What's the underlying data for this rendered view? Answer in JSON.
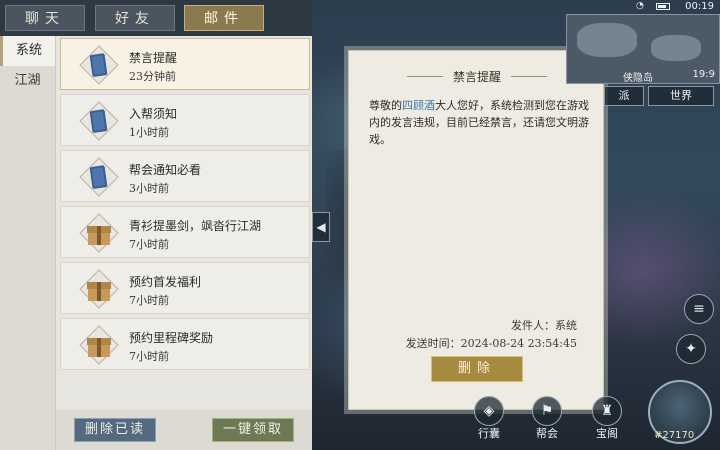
{
  "tabs": [
    {
      "label": "聊天"
    },
    {
      "label": "好友"
    },
    {
      "label": "邮件"
    }
  ],
  "side": [
    {
      "label": "系统"
    },
    {
      "label": "江湖"
    }
  ],
  "mails": [
    {
      "subject": "禁言提醒",
      "time": "23分钟前",
      "icon": "letter-icon"
    },
    {
      "subject": "入帮须知",
      "time": "1小时前",
      "icon": "letter-icon"
    },
    {
      "subject": "帮会通知必看",
      "time": "3小时前",
      "icon": "letter-icon"
    },
    {
      "subject": "青衫提墨剑，飒沓行江湖",
      "time": "7小时前",
      "icon": "gift-box-icon"
    },
    {
      "subject": "预约首发福利",
      "time": "7小时前",
      "icon": "gift-box-icon"
    },
    {
      "subject": "预约里程碑奖励",
      "time": "7小时前",
      "icon": "gift-box-icon"
    }
  ],
  "buttons": {
    "delete_read": "删除已读",
    "claim_all": "一键领取",
    "delete": "删除"
  },
  "letter": {
    "title": "禁言提醒",
    "body_pre": "尊敬的",
    "body_name": "四顾酒",
    "body_post": "大人您好，系统检测到您在游戏内的发言违规，目前已经禁言，还请您文明游戏。",
    "sender": "发件人：系统",
    "sent_time": "发送时间：2024-08-24 23:54:45"
  },
  "status": {
    "clock": "00:19"
  },
  "minimap": {
    "location": "侠隐岛",
    "coord": "19:9"
  },
  "hud": {
    "sect": "派",
    "world": "世界",
    "bag": "行囊",
    "guild": "帮会",
    "treasure": "宝阁",
    "power": "#27170"
  },
  "colors": {
    "accent_gold": "#a68a3f",
    "highlight_blue": "#3f73a8"
  }
}
